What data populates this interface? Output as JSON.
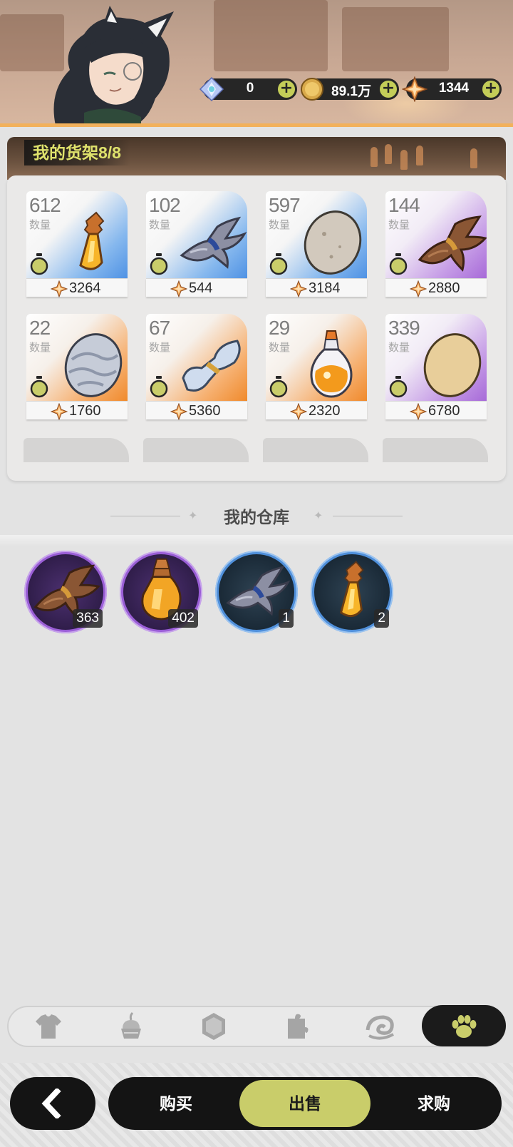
{
  "currencies": [
    {
      "icon": "crystal-icon",
      "value": "0"
    },
    {
      "icon": "gold-coin-icon",
      "value": "89.1万"
    },
    {
      "icon": "star-gem-icon",
      "value": "1344"
    }
  ],
  "shelf": {
    "title": "我的货架8/8",
    "qty_label": "数量",
    "items": [
      {
        "qty": "612",
        "price": "3264",
        "rarity": "blue",
        "item": "potion-bottle-icon"
      },
      {
        "qty": "102",
        "price": "544",
        "rarity": "blue",
        "item": "gray-fur-bundle-icon"
      },
      {
        "qty": "597",
        "price": "3184",
        "rarity": "blue",
        "item": "gray-egg-icon"
      },
      {
        "qty": "144",
        "price": "2880",
        "rarity": "purple",
        "item": "brown-fur-bundle-icon"
      },
      {
        "qty": "22",
        "price": "1760",
        "rarity": "orange",
        "item": "patterned-egg-icon"
      },
      {
        "qty": "67",
        "price": "5360",
        "rarity": "orange",
        "item": "cloth-bundle-icon"
      },
      {
        "qty": "29",
        "price": "2320",
        "rarity": "orange",
        "item": "fancy-flask-icon"
      },
      {
        "qty": "339",
        "price": "6780",
        "rarity": "purple",
        "item": "tan-egg-icon"
      }
    ]
  },
  "warehouse": {
    "title": "我的仓库",
    "items": [
      {
        "count": "363",
        "rarity": "purple",
        "item": "brown-fur-bundle-icon"
      },
      {
        "count": "402",
        "rarity": "purple",
        "item": "amber-flask-icon"
      },
      {
        "count": "1",
        "rarity": "blue",
        "item": "gray-fur-bundle-icon"
      },
      {
        "count": "2",
        "rarity": "blue",
        "item": "potion-bottle-icon"
      }
    ]
  },
  "categories": [
    {
      "icon": "shirt-icon",
      "active": false
    },
    {
      "icon": "dessert-icon",
      "active": false
    },
    {
      "icon": "gem-icon",
      "active": false
    },
    {
      "icon": "puzzle-icon",
      "active": false
    },
    {
      "icon": "swirl-icon",
      "active": false
    },
    {
      "icon": "paw-icon",
      "active": true
    }
  ],
  "bottom": {
    "back_icon": "back-arrow-icon",
    "buy": "购买",
    "sell": "出售",
    "request": "求购",
    "active_mode": "出售"
  },
  "colors": {
    "accent": "#c9cd6a",
    "title_yellow": "#dfe26c",
    "rarity_blue": "#4f92e4",
    "rarity_orange": "#f08a2c",
    "rarity_purple": "#a76ad8"
  }
}
